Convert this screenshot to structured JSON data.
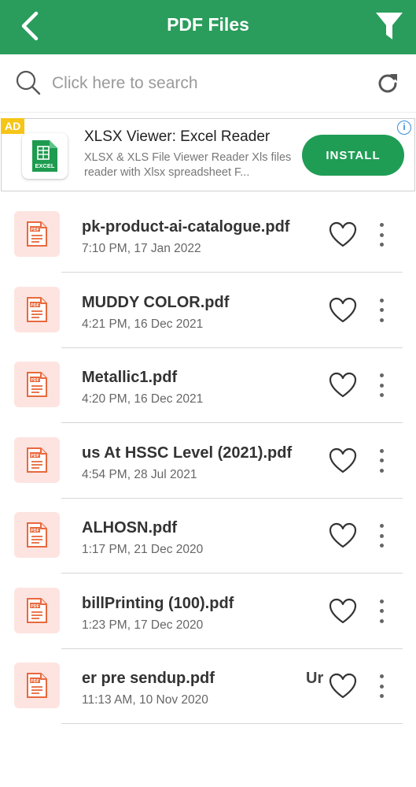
{
  "header": {
    "title": "PDF Files",
    "back_icon": "back-arrow-icon",
    "filter_icon": "filter-icon",
    "bg_color": "#2a9d5c"
  },
  "search": {
    "placeholder": "Click here to search",
    "value": ""
  },
  "ad": {
    "badge": "AD",
    "info": "i",
    "app_icon_label": "EXCEL",
    "title": "XLSX Viewer: Excel Reader",
    "description": "XLSX & XLS File Viewer Reader Xls files reader with Xlsx spreadsheet F...",
    "install_label": "INSTALL",
    "install_color": "#1f9d55"
  },
  "files": [
    {
      "name": "pk-product-ai-catalogue.pdf",
      "date": "7:10 PM, 17 Jan 2022",
      "trail": ""
    },
    {
      "name": "MUDDY COLOR.pdf",
      "date": "4:21 PM, 16 Dec 2021",
      "trail": ""
    },
    {
      "name": "Metallic1.pdf",
      "date": "4:20 PM, 16 Dec 2021",
      "trail": ""
    },
    {
      "name": "us At HSSC Level (2021).pdf",
      "date": "4:54 PM, 28 Jul 2021",
      "trail": ""
    },
    {
      "name": "ALHOSN.pdf",
      "date": "1:17 PM, 21 Dec 2020",
      "trail": ""
    },
    {
      "name": "billPrinting (100).pdf",
      "date": "1:23 PM, 17 Dec 2020",
      "trail": ""
    },
    {
      "name": "er pre sendup.pdf",
      "date": "11:13 AM, 10 Nov 2020",
      "trail": "Ur"
    }
  ],
  "file_icon_label": "PDF"
}
